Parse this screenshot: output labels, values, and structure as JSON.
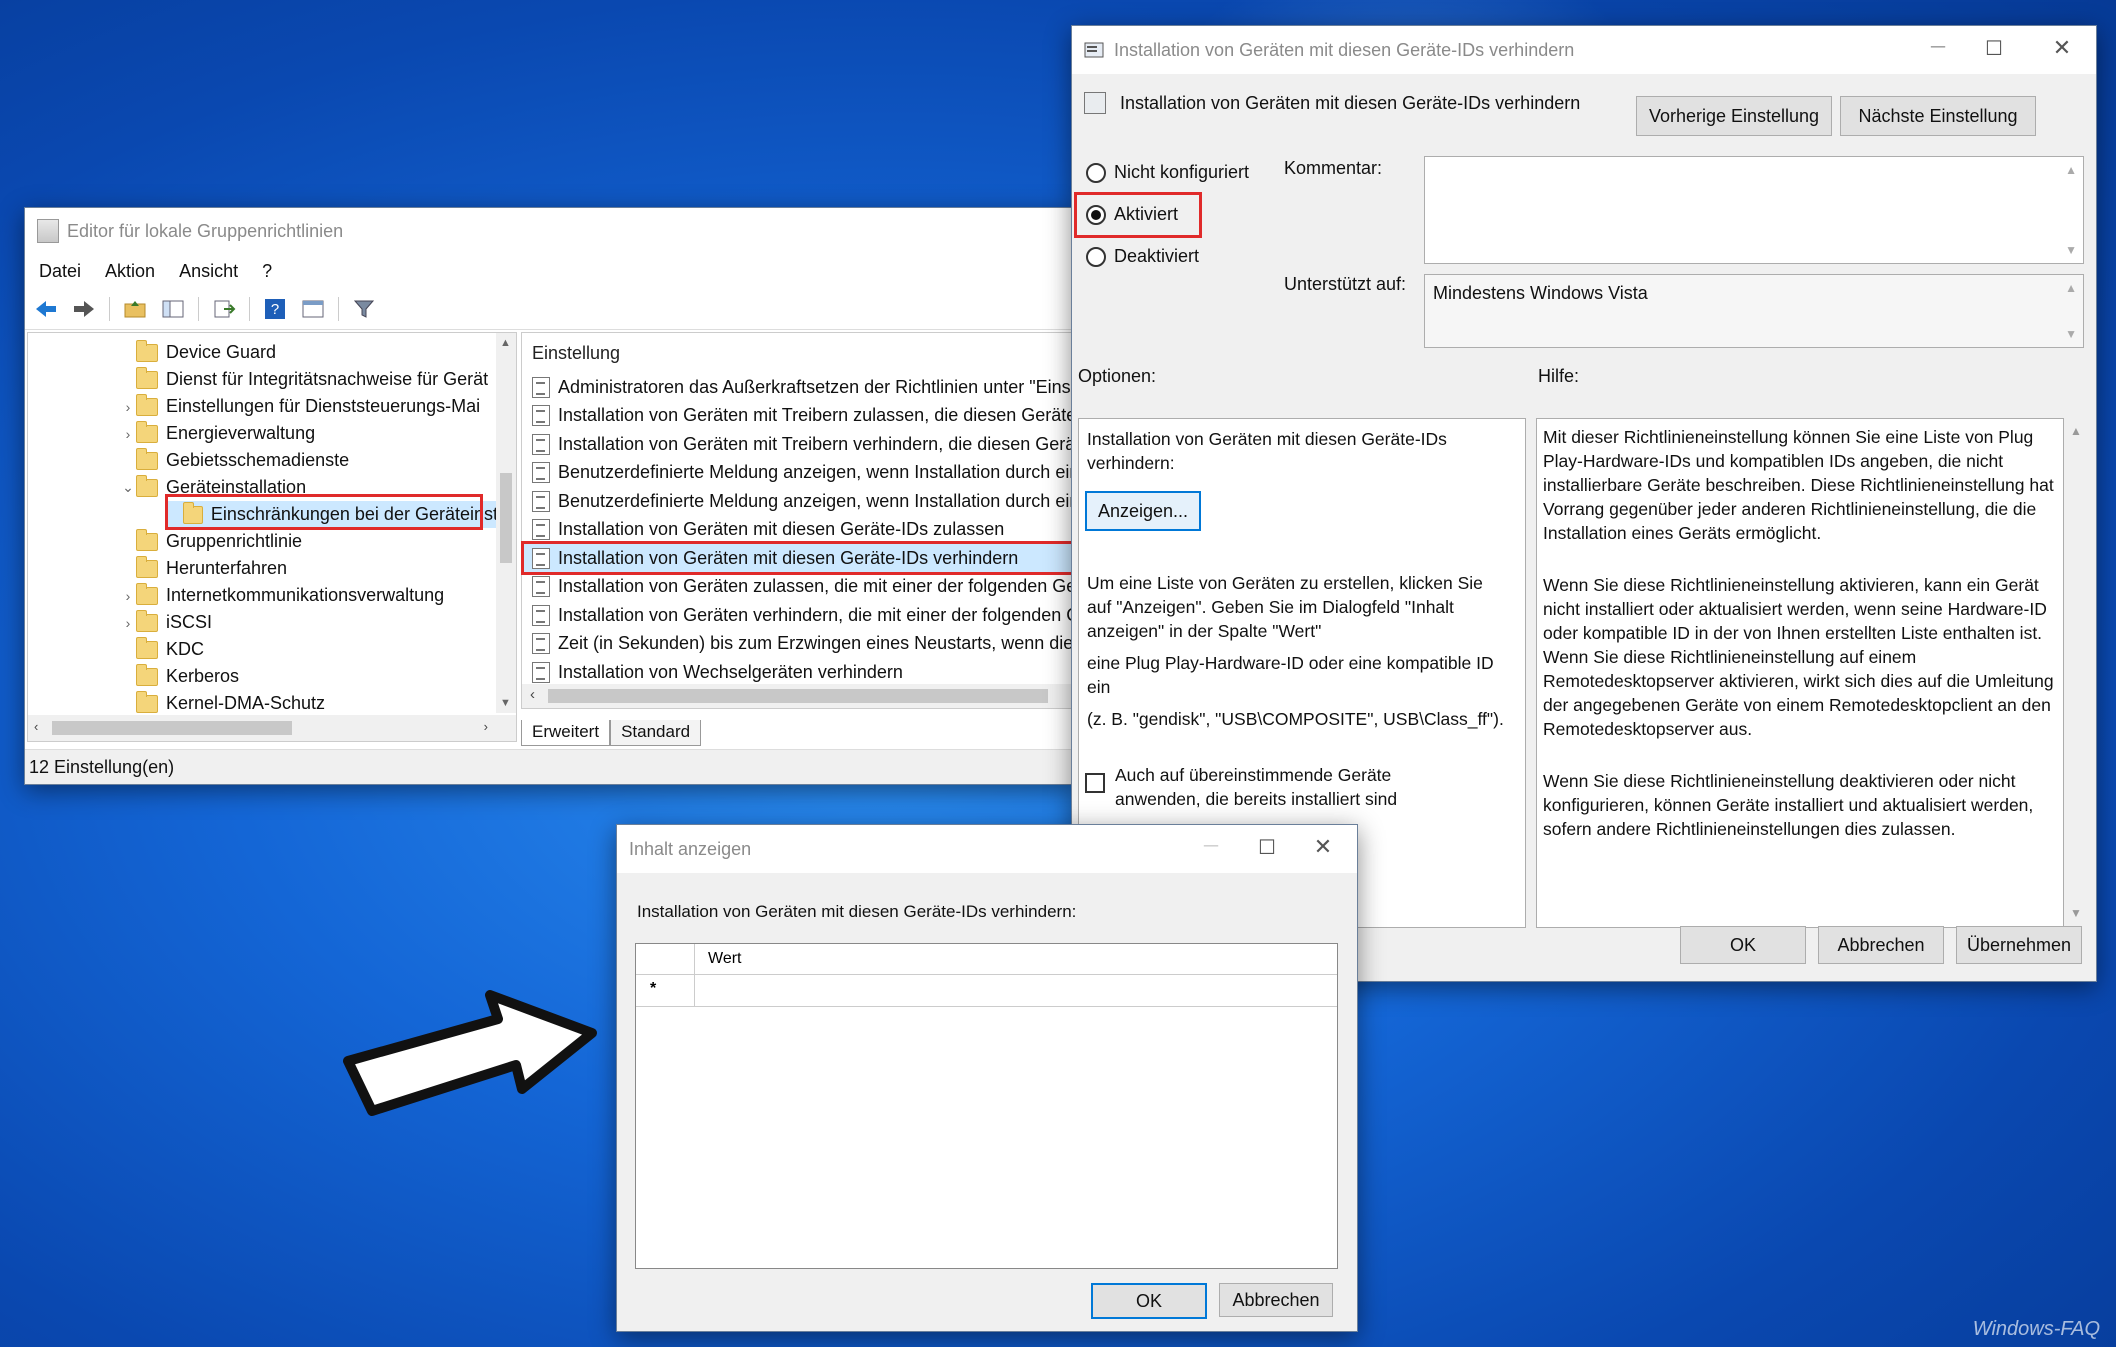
{
  "gpe": {
    "title": "Editor für lokale Gruppenrichtlinien",
    "menu": [
      "Datei",
      "Aktion",
      "Ansicht",
      "?"
    ],
    "tree": [
      {
        "label": "Device Guard",
        "chev": "",
        "indent": 1
      },
      {
        "label": "Dienst für Integritätsnachweise für Gerät",
        "chev": "",
        "indent": 1
      },
      {
        "label": "Einstellungen für Dienststeuerungs-Mai",
        "chev": "›",
        "indent": 1
      },
      {
        "label": "Energieverwaltung",
        "chev": "›",
        "indent": 1
      },
      {
        "label": "Gebietsschemadienste",
        "chev": "",
        "indent": 1
      },
      {
        "label": "Geräteinstallation",
        "chev": "⌄",
        "indent": 1
      },
      {
        "label": "Einschränkungen bei der Geräteinst",
        "chev": "",
        "indent": 2
      },
      {
        "label": "Gruppenrichtlinie",
        "chev": "",
        "indent": 1
      },
      {
        "label": "Herunterfahren",
        "chev": "",
        "indent": 1
      },
      {
        "label": "Internetkommunikationsverwaltung",
        "chev": "›",
        "indent": 1
      },
      {
        "label": "iSCSI",
        "chev": "›",
        "indent": 1
      },
      {
        "label": "KDC",
        "chev": "",
        "indent": 1
      },
      {
        "label": "Kerberos",
        "chev": "",
        "indent": 1
      },
      {
        "label": "Kernel-DMA-Schutz",
        "chev": "",
        "indent": 1
      }
    ],
    "list_header": "Einstellung",
    "list": [
      "Administratoren das Außerkraftsetzen der Richtlinien unter \"Einsch",
      "Installation von Geräten mit Treibern zulassen, die diesen Gerätese",
      "Installation von Geräten mit Treibern verhindern, die diesen Geräte",
      "Benutzerdefinierte Meldung anzeigen, wenn Installation durch ein",
      "Benutzerdefinierte Meldung anzeigen, wenn Installation durch ein",
      "Installation von Geräten mit diesen Geräte-IDs zulassen",
      "Installation von Geräten mit diesen Geräte-IDs verhindern",
      "Installation von Geräten zulassen, die mit einer der folgenden Gerä",
      "Installation von Geräten verhindern, die mit einer der folgenden G",
      "Zeit (in Sekunden) bis zum Erzwingen eines Neustarts, wenn dieser",
      "Installation von Wechselgeräten verhindern"
    ],
    "tabs": [
      "Erweitert",
      "Standard"
    ],
    "status": "12 Einstellung(en)"
  },
  "policy": {
    "title": "Installation von Geräten mit diesen Geräte-IDs verhindern",
    "heading": "Installation von Geräten mit diesen Geräte-IDs verhindern",
    "prev_btn": "Vorherige Einstellung",
    "next_btn": "Nächste Einstellung",
    "radio_not_configured": "Nicht konfiguriert",
    "radio_enabled": "Aktiviert",
    "radio_disabled": "Deaktiviert",
    "selected_state": "Aktiviert",
    "comment_label": "Kommentar:",
    "supported_label": "Unterstützt auf:",
    "supported_value": "Mindestens Windows Vista",
    "options_label": "Optionen:",
    "help_label": "Hilfe:",
    "options_title": "Installation von Geräten mit diesen Geräte-IDs verhindern:",
    "show_btn": "Anzeigen...",
    "options_p1": "Um eine Liste von Geräten zu erstellen, klicken Sie auf \"Anzeigen\". Geben Sie im Dialogfeld \"Inhalt anzeigen\" in der Spalte \"Wert\"",
    "options_p2": "eine Plug  Play-Hardware-ID oder eine kompatible ID ein",
    "options_p3": "(z. B. \"gendisk\", \"USB\\COMPOSITE\", USB\\Class_ff\").",
    "checkbox_label": "Auch auf übereinstimmende Geräte anwenden, die bereits installiert sind",
    "help_p1": "Mit dieser Richtlinieneinstellung können Sie eine Liste von Plug Play-Hardware-IDs und kompatiblen IDs angeben, die nicht installierbare Geräte beschreiben. Diese Richtlinieneinstellung hat Vorrang gegenüber jeder anderen Richtlinieneinstellung, die die Installation eines Geräts ermöglicht.",
    "help_p2": "Wenn Sie diese Richtlinieneinstellung aktivieren, kann ein Gerät nicht installiert oder aktualisiert werden, wenn seine Hardware-ID oder kompatible ID in der von Ihnen erstellten Liste enthalten ist. Wenn Sie diese Richtlinieneinstellung auf einem Remotedesktopserver aktivieren, wirkt sich dies auf die Umleitung der angegebenen Geräte von einem Remotedesktopclient an den Remotedesktopserver aus.",
    "help_p3": "Wenn Sie diese Richtlinieneinstellung deaktivieren oder nicht konfigurieren, können Geräte installiert und aktualisiert werden, sofern andere Richtlinieneinstellungen dies zulassen.",
    "ok": "OK",
    "cancel": "Abbrechen",
    "apply": "Übernehmen"
  },
  "inhalt": {
    "title": "Inhalt anzeigen",
    "label": "Installation von Geräten mit diesen Geräte-IDs verhindern:",
    "col_header": "Wert",
    "new_row_marker": "*",
    "ok": "OK",
    "cancel": "Abbrechen"
  },
  "watermark": "Windows-FAQ",
  "colors": {
    "highlight_box": "#e02a2a",
    "desktop": "#1466d6",
    "selection": "#cce8ff"
  }
}
